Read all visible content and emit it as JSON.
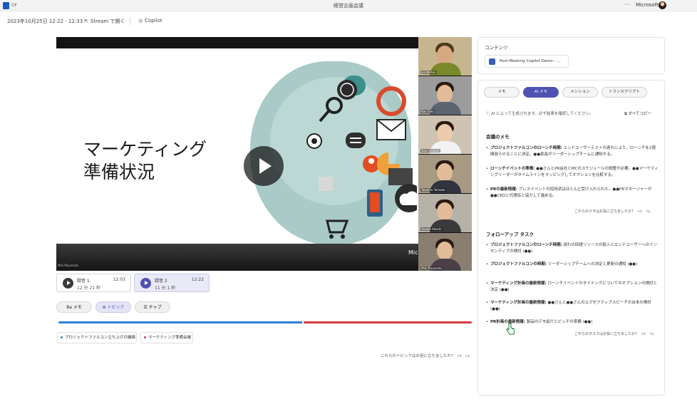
{
  "app": {
    "title": "経営企画会議",
    "account": "Microsoft",
    "file_label": "DF"
  },
  "meeting": {
    "date": "2023年10月25日 12:22 - 12:33",
    "stream_btn": "Stream で開く",
    "copilot_btn": "Copilot"
  },
  "video": {
    "slide_title_1": "マーケティング",
    "slide_title_2": "準備状況",
    "brand": "Microsoft Stream",
    "presenter": "Miki Miyamoto",
    "participants": [
      "Jon Barton",
      "Ron Sato",
      "Yuzu Shibata",
      "Takahiro Yamada",
      "Yusuke Adachi",
      "Miki Miyamoto"
    ]
  },
  "recordings": [
    {
      "label": "録音 1",
      "duration": "12 分 21 秒",
      "time": "12:03"
    },
    {
      "label": "録音 2",
      "duration": "11 分 1 秒",
      "time": "12:22"
    }
  ],
  "view_tabs": [
    {
      "label": "8a メモ",
      "active": false
    },
    {
      "label": "トピック",
      "active": true
    },
    {
      "label": "チャプ",
      "active": false
    }
  ],
  "progress": {
    "topic1_fraction": 0.59,
    "colors": {
      "topic1": "#2f7fd0",
      "topic2": "#d93a44"
    }
  },
  "topics": [
    "プロジェクトファルコン立ち上げの議論",
    "マーケティング準備会議"
  ],
  "topics_feedback": "これらのトピックはお役に立ちましたか?",
  "right_panel": {
    "content_header": "コンテンツ",
    "file_name": "Post-Meeting Copilot Demo - ...",
    "tabs": [
      {
        "label": "メモ",
        "active": false
      },
      {
        "label": "AI メモ",
        "active": true
      },
      {
        "label": "メンション",
        "active": false
      },
      {
        "label": "トランスクリプト",
        "active": false
      }
    ],
    "notice": "AI によって生成されます。必ず結果を確認してください。",
    "copy_all": "すべてコピー",
    "notes_title": "会議のメモ",
    "notes": [
      {
        "bold": "プロジェクトファルコンのローンチ時期:",
        "text": " エンドユーザーテストの遅れにより、ローンチを2週間遅らせることに決定。●●部長がリーダーシップチームに通知する。"
      },
      {
        "bold": "ローンチイベントの準備:",
        "text": " ●●さんとPR会社とMCのスケジュールの調整が必要。●●マーケティングリーダーがタイムラインをマッピングしてオプションを比較する。"
      },
      {
        "bold": "PRの最新情報:",
        "text": " プレスイベントの招待状はほとんど受け入れられた。●●PRマネージャーが●●CEOと代理店と協力して進める。"
      }
    ],
    "notes_feedback": "これらのメモはお役に立ちましたか?",
    "followup_title": "フォローアップ タスク",
    "followups": [
      {
        "bold": "プロジェクトファルコンのローンチ時期:",
        "text": " 遅れの回復リソースの投入とエンドユーザーへのインセンティブの検討 (●●)"
      },
      {
        "bold": "プロジェクトファルコンの時期:",
        "text": " リーダーシップチームへの決定と更新の通知 (●●)"
      },
      {
        "bold": "マーケティング計画の最新情報:",
        "text": " ローンチイベントのタイミングについてのオプションの検討と決定 (●●)"
      },
      {
        "bold": "マーケティング計画の最新情報:",
        "text": " ●●さんと●●さんのエグゼクティブスピーチの台本の検討 (●●)"
      },
      {
        "bold": "PR計画の最新情報:",
        "text": " 製品のデモ紹介とピッチの準備 (●●)"
      }
    ],
    "tasks_feedback": "これらのタスクはお役に立ちましたか?"
  }
}
